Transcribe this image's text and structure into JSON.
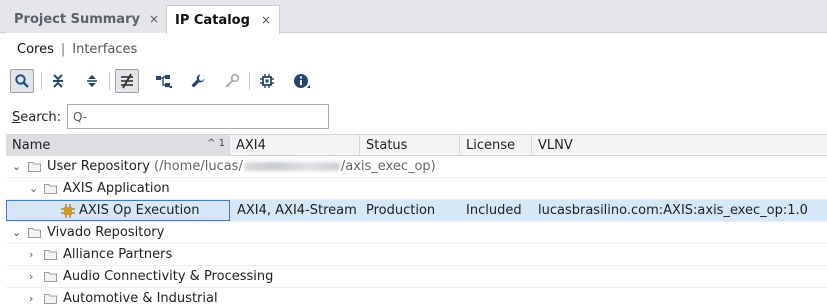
{
  "tabs": {
    "project_summary": "Project Summary",
    "ip_catalog": "IP Catalog",
    "close_glyph": "×"
  },
  "subtabs": {
    "cores": "Cores",
    "separator": "|",
    "interfaces": "Interfaces"
  },
  "toolbar": {
    "icons": [
      "search-icon",
      "collapse-all-icon",
      "expand-all-icon",
      "filter-icon",
      "hierarchy-icon",
      "wrench-icon",
      "key-icon",
      "chip-icon",
      "info-icon"
    ]
  },
  "search": {
    "label_underlined": "S",
    "label_rest": "earch:",
    "placeholder": "Q-"
  },
  "table": {
    "columns": {
      "name": "Name",
      "sort_indicator": "^ 1",
      "axi4": "AXI4",
      "status": "Status",
      "license": "License",
      "vlnv": "VLNV"
    },
    "rows": {
      "user_repository": {
        "label": "User Repository",
        "path_prefix": "(/home/lucas/",
        "path_suffix": "/axis_exec_op)"
      },
      "axis_application": {
        "label": "AXIS Application"
      },
      "axis_op_execution": {
        "label": "AXIS Op Execution",
        "axi4": "AXI4, AXI4-Stream",
        "status": "Production",
        "license": "Included",
        "vlnv": "lucasbrasilino.com:AXIS:axis_exec_op:1.0"
      },
      "vivado_repository": {
        "label": "Vivado Repository"
      },
      "alliance_partners": {
        "label": "Alliance Partners"
      },
      "audio": {
        "label": "Audio Connectivity & Processing"
      },
      "automotive": {
        "label": "Automotive & Industrial"
      }
    }
  },
  "colors": {
    "selection_bg": "#d6e7f7",
    "selection_border": "#3d7bc8",
    "ip_icon": "#d09a2a",
    "tabbar_bg": "#e4e6ea"
  }
}
